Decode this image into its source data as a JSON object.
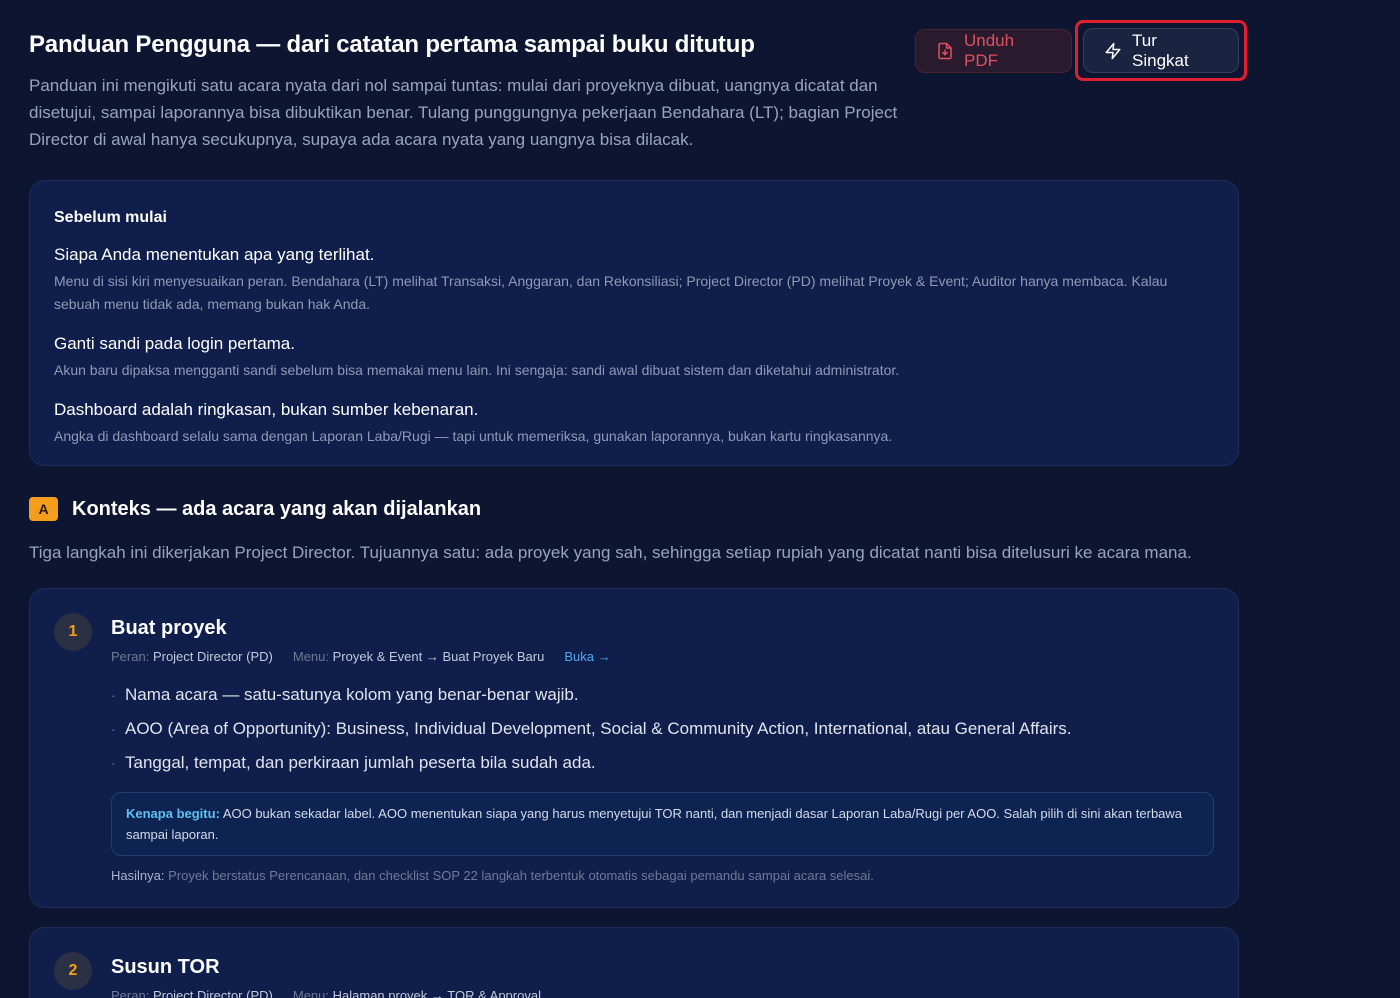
{
  "header": {
    "title": "Panduan Pengguna — dari catatan pertama sampai buku ditutup",
    "description": "Panduan ini mengikuti satu acara nyata dari nol sampai tuntas: mulai dari proyeknya dibuat, uangnya dicatat dan disetujui, sampai laporannya bisa dibuktikan benar. Tulang punggungnya pekerjaan Bendahara (LT); bagian Project Director di awal hanya secukupnya, supaya ada acara nyata yang uangnya bisa dilacak.",
    "download_label": "Unduh PDF",
    "tour_label": "Tur Singkat"
  },
  "intro": {
    "heading": "Sebelum mulai",
    "items": [
      {
        "title": "Siapa Anda menentukan apa yang terlihat.",
        "body": "Menu di sisi kiri menyesuaikan peran. Bendahara (LT) melihat Transaksi, Anggaran, dan Rekonsiliasi; Project Director (PD) melihat Proyek & Event; Auditor hanya membaca. Kalau sebuah menu tidak ada, memang bukan hak Anda."
      },
      {
        "title": "Ganti sandi pada login pertama.",
        "body": "Akun baru dipaksa mengganti sandi sebelum bisa memakai menu lain. Ini sengaja: sandi awal dibuat sistem dan diketahui administrator."
      },
      {
        "title": "Dashboard adalah ringkasan, bukan sumber kebenaran.",
        "body": "Angka di dashboard selalu sama dengan Laporan Laba/Rugi — tapi untuk memeriksa, gunakan laporannya, bukan kartu ringkasannya."
      }
    ]
  },
  "section_a": {
    "badge": "A",
    "title": "Konteks — ada acara yang akan dijalankan",
    "description": "Tiga langkah ini dikerjakan Project Director. Tujuannya satu: ada proyek yang sah, sehingga setiap rupiah yang dicatat nanti bisa ditelusuri ke acara mana."
  },
  "steps": [
    {
      "number": "1",
      "title": "Buat proyek",
      "role_label": "Peran:",
      "role": "Project Director (PD)",
      "menu_label": "Menu:",
      "menu": "Proyek & Event → Buat Proyek Baru",
      "open_link": "Buka →",
      "bullets": [
        "Nama acara — satu-satunya kolom yang benar-benar wajib.",
        "AOO (Area of Opportunity): Business, Individual Development, Social & Community Action, International, atau General Affairs.",
        "Tanggal, tempat, dan perkiraan jumlah peserta bila sudah ada."
      ],
      "why_label": "Kenapa begitu:",
      "why_text": "AOO bukan sekadar label. AOO menentukan siapa yang harus menyetujui TOR nanti, dan menjadi dasar Laporan Laba/Rugi per AOO. Salah pilih di sini akan terbawa sampai laporan.",
      "result_label": "Hasilnya:",
      "result_text": "Proyek berstatus Perencanaan, dan checklist SOP 22 langkah terbentuk otomatis sebagai pemandu sampai acara selesai."
    },
    {
      "number": "2",
      "title": "Susun TOR",
      "role_label": "Peran:",
      "role": "Project Director (PD)",
      "menu_label": "Menu:",
      "menu": "Halaman proyek → TOR & Approval"
    }
  ]
}
